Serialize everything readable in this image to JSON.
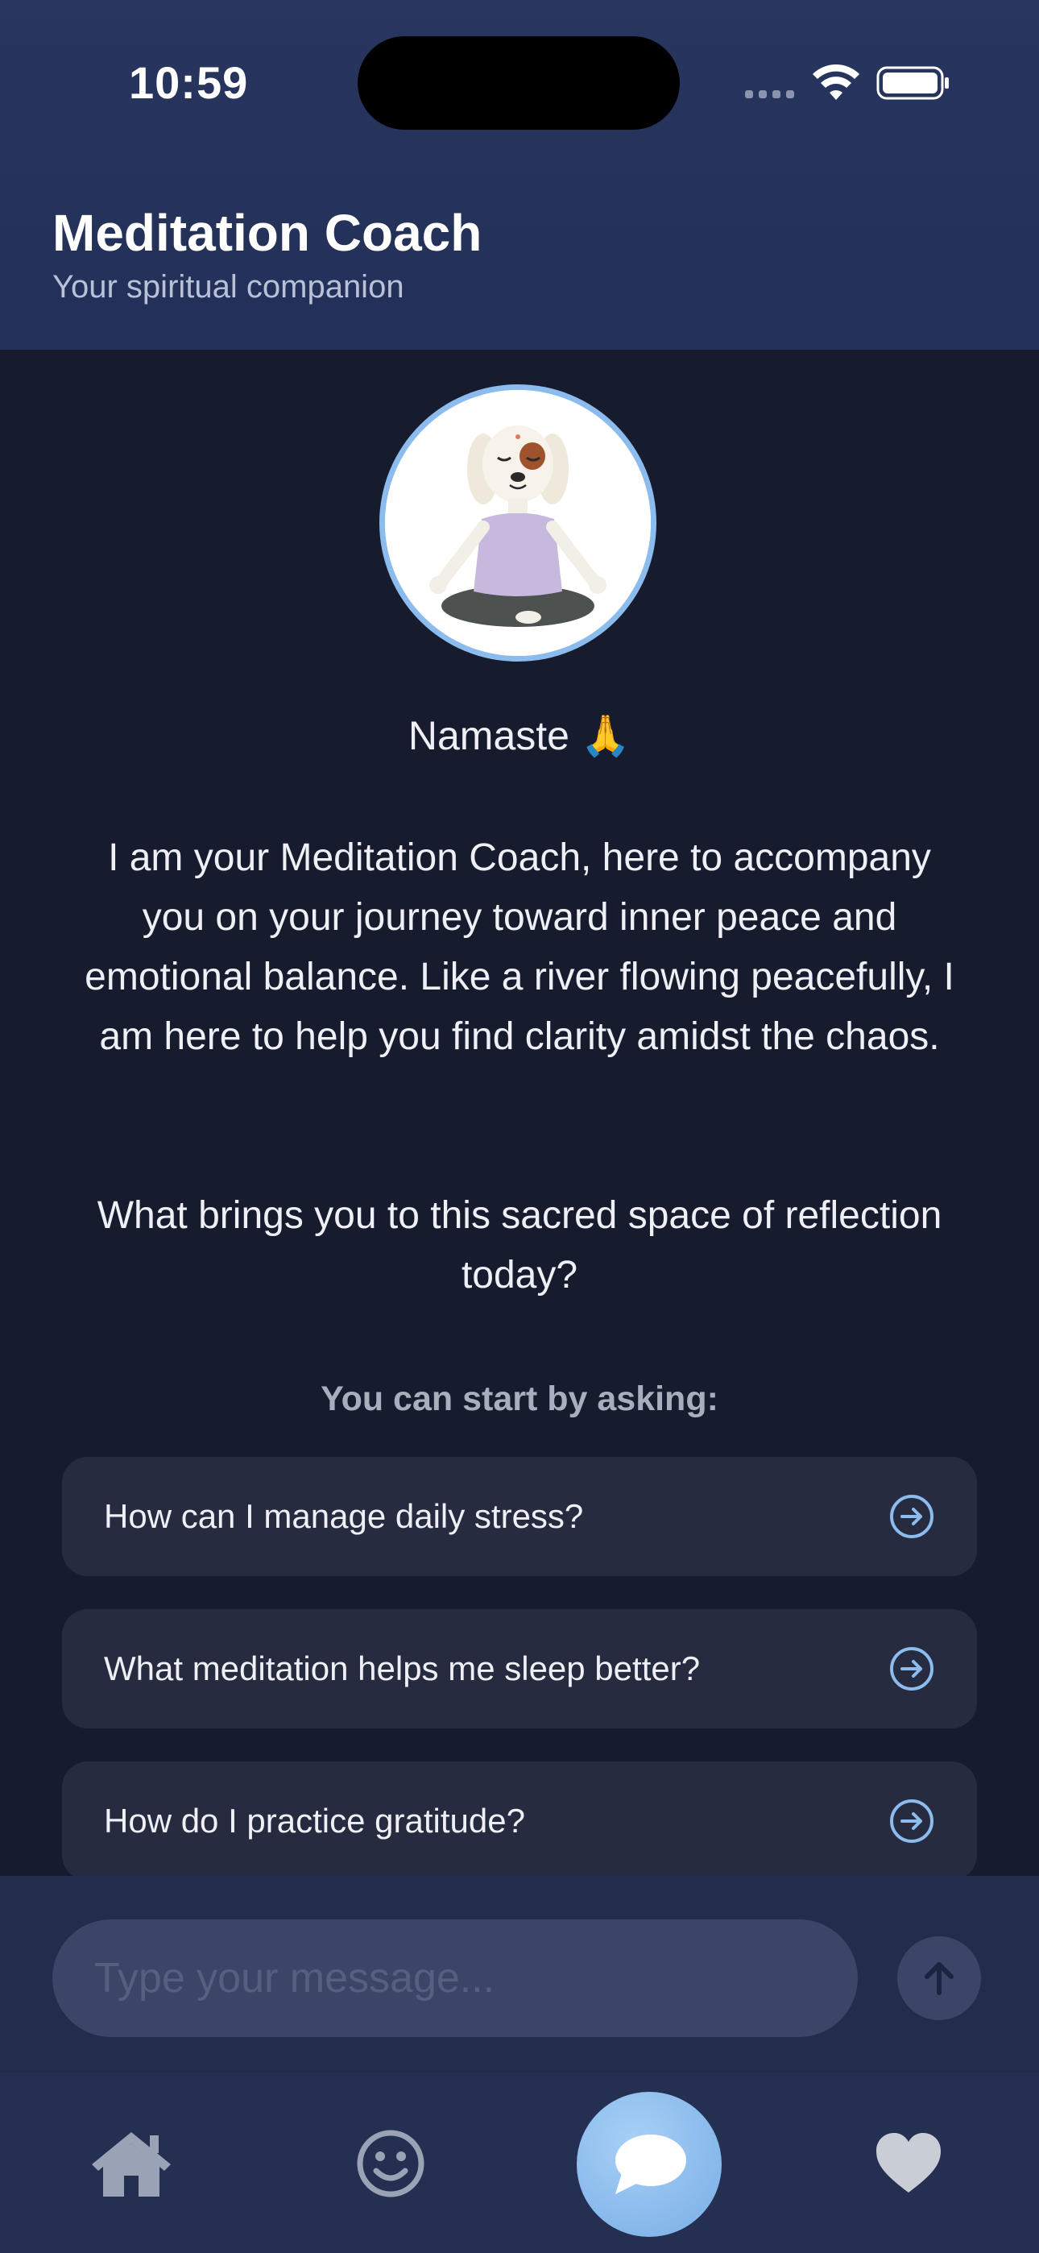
{
  "status_bar": {
    "time": "10:59"
  },
  "header": {
    "title": "Meditation Coach",
    "subtitle": "Your spiritual companion"
  },
  "welcome": {
    "greeting": "Namaste 🙏",
    "intro": "I am your Meditation Coach, here to accompany you on your journey toward inner peace and emotional balance. Like a river flowing peacefully, I am here to help you find clarity amidst the chaos.",
    "question": "What brings you to this sacred space of reflection today?"
  },
  "suggestions": {
    "label": "You can start by asking:",
    "items": [
      {
        "text": "How can I manage daily stress?",
        "icon": "arrow-circle-right-icon"
      },
      {
        "text": "What meditation helps me sleep better?",
        "icon": "arrow-circle-right-icon"
      },
      {
        "text": "How do I practice gratitude?",
        "icon": "arrow-circle-right-icon"
      }
    ]
  },
  "composer": {
    "placeholder": "Type your message...",
    "send_icon": "arrow-up-icon"
  },
  "tab_bar": {
    "tabs": [
      {
        "name": "home",
        "icon": "house-icon",
        "active": false
      },
      {
        "name": "mood",
        "icon": "smiley-icon",
        "active": false
      },
      {
        "name": "chat",
        "icon": "chat-bubble-icon",
        "active": true
      },
      {
        "name": "favorites",
        "icon": "heart-icon",
        "active": false
      }
    ]
  },
  "colors": {
    "header_bg": "#283660",
    "page_bg": "#161b2e",
    "card_bg": "#262b3f",
    "accent": "#8cbbed",
    "tab_bar_bg": "#252f52"
  }
}
